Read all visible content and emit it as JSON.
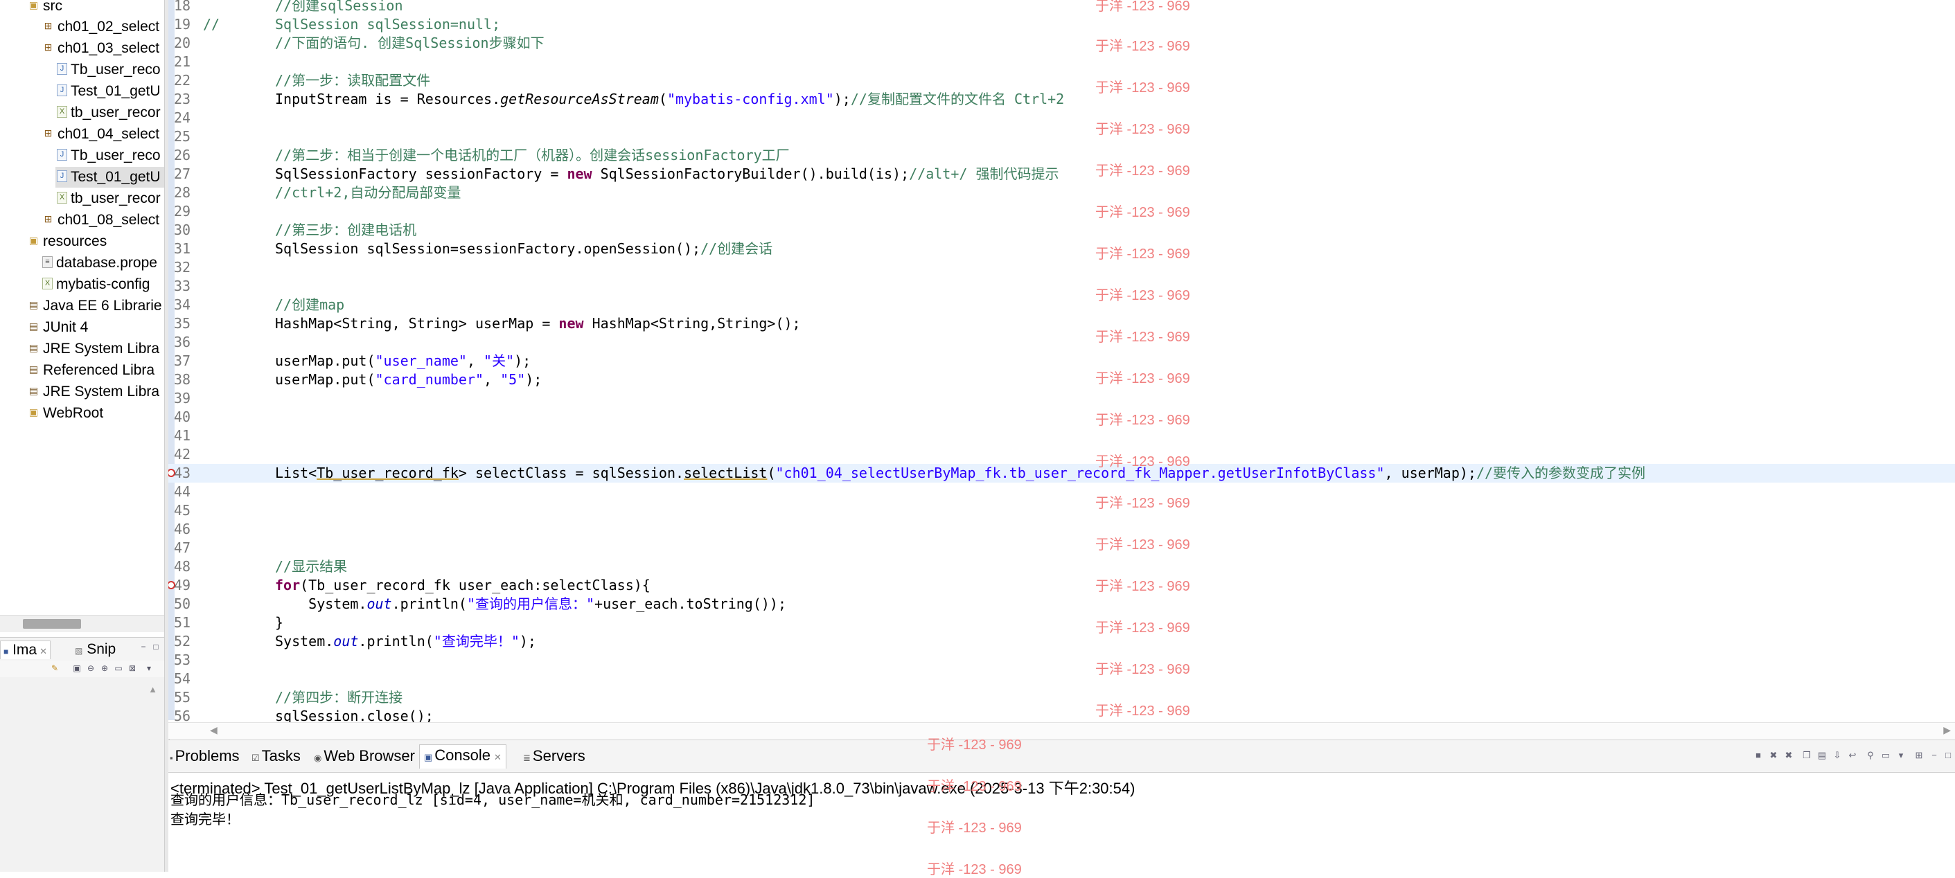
{
  "package_explorer": {
    "items": [
      {
        "label": "src",
        "icon": "folder-icon"
      },
      {
        "label": "ch01_02_select",
        "icon": "package-icon"
      },
      {
        "label": "ch01_03_select",
        "icon": "package-icon"
      },
      {
        "label": "Tb_user_reco",
        "icon": "java-file-icon"
      },
      {
        "label": "Test_01_getU",
        "icon": "java-file-icon"
      },
      {
        "label": "tb_user_recor",
        "icon": "xml-file-icon"
      },
      {
        "label": "ch01_04_select",
        "icon": "package-icon"
      },
      {
        "label": "Tb_user_reco",
        "icon": "java-file-icon"
      },
      {
        "label": "Test_01_getU",
        "icon": "java-file-icon"
      },
      {
        "label": "tb_user_recor",
        "icon": "xml-file-icon"
      },
      {
        "label": "ch01_08_select",
        "icon": "package-icon"
      },
      {
        "label": "resources",
        "icon": "folder-icon"
      },
      {
        "label": "database.prope",
        "icon": "properties-file-icon"
      },
      {
        "label": "mybatis-config",
        "icon": "xml-file-icon"
      },
      {
        "label": "Java EE 6 Librarie",
        "icon": "library-icon"
      },
      {
        "label": "JUnit 4",
        "icon": "library-icon"
      },
      {
        "label": "JRE System Libra",
        "icon": "library-icon"
      },
      {
        "label": "Referenced Libra",
        "icon": "library-icon"
      },
      {
        "label": "JRE System Libra",
        "icon": "library-icon"
      },
      {
        "label": "WebRoot",
        "icon": "folder-icon"
      }
    ]
  },
  "left_tabs": {
    "tab1": "Ima",
    "tab2": "Snip"
  },
  "editor": {
    "line_numbers": [
      "18",
      "19",
      "20",
      "21",
      "22",
      "23",
      "24",
      "25",
      "26",
      "27",
      "28",
      "29",
      "30",
      "31",
      "32",
      "33",
      "34",
      "35",
      "36",
      "37",
      "38",
      "39",
      "40",
      "41",
      "42",
      "43",
      "44",
      "45",
      "46",
      "47",
      "48",
      "49",
      "50",
      "51",
      "52",
      "53",
      "54",
      "55",
      "56"
    ],
    "code": {
      "l18_comment": "//创建sqlSession",
      "l19_prefix": "//",
      "l19_code": "SqlSession sqlSession=null;",
      "l20_comment": "//下面的语句. 创建SqlSession步骤如下",
      "l22_comment": "//第一步：读取配置文件",
      "l23_a": "InputStream is = Resources.",
      "l23_method": "getResourceAsStream",
      "l23_b": "(",
      "l23_str": "\"mybatis-config.xml\"",
      "l23_c": ");",
      "l23_comment": "//复制配置文件的文件名 Ctrl+2",
      "l26_comment": "//第二步：相当于创建一个电话机的工厂（机器）。创建会话sessionFactory工厂",
      "l27_a": "SqlSessionFactory sessionFactory = ",
      "l27_kw": "new",
      "l27_b": " SqlSessionFactoryBuilder().build(is);",
      "l27_comment": "//alt+/ 强制代码提示",
      "l28_comment": "//ctrl+2,自动分配局部变量",
      "l30_comment": "//第三步：创建电话机",
      "l31_a": "SqlSession sqlSession=sessionFactory.openSession();",
      "l31_comment": "//创建会话",
      "l34_comment": "//创建map",
      "l35_a": "HashMap<String, String> userMap = ",
      "l35_kw": "new",
      "l35_b": " HashMap<String,String>();",
      "l37_a": "userMap.put(",
      "l37_s1": "\"user_name\"",
      "l37_b": ", ",
      "l37_s2": "\"关\"",
      "l37_c": ");",
      "l38_a": "userMap.put(",
      "l38_s1": "\"card_number\"",
      "l38_b": ", ",
      "l38_s2": "\"5\"",
      "l38_c": ");",
      "l43_a": "List<",
      "l43_type": "Tb_user_record_fk",
      "l43_b": "> selectClass = sqlSession.",
      "l43_method": "selectList",
      "l43_c": "(",
      "l43_str": "\"ch01_04_selectUserByMap_fk.tb_user_record_fk_Mapper.getUserInfotByClass\"",
      "l43_d": ", userMap);",
      "l43_comment": "//要传入的参数变成了实例",
      "l48_comment": "//显示结果",
      "l49_kw": "for",
      "l49_a": "(Tb_user_record_fk user_each:selectClass){",
      "l50_a": "    System.",
      "l50_field": "out",
      "l50_b": ".println(",
      "l50_str": "\"查询的用户信息：\"",
      "l50_c": "+user_each.toString());",
      "l51_a": "}",
      "l52_a": "System.",
      "l52_field": "out",
      "l52_b": ".println(",
      "l52_str": "\"查询完毕！\"",
      "l52_c": ");",
      "l55_comment": "//第四步：断开连接",
      "l56_a": "sqlSession.close();"
    },
    "watermark": "于洋 -123 - 969"
  },
  "console": {
    "tabs": [
      {
        "label": "Problems",
        "icon": "problems-icon"
      },
      {
        "label": "Tasks",
        "icon": "tasks-icon"
      },
      {
        "label": "Web Browser",
        "icon": "globe-icon"
      },
      {
        "label": "Console",
        "icon": "console-icon"
      },
      {
        "label": "Servers",
        "icon": "servers-icon"
      }
    ],
    "status": "<terminated> Test_01_getUserListByMap_lz [Java Application] C:\\Program Files (x86)\\Java\\jdk1.8.0_73\\bin\\javaw.exe (2025-3-13 下午2:30:54)",
    "out1_prefix": "查询的用户信息：",
    "out1_body": "Tb_user_record_lz [sid=4, user_name=",
    "out1_name": "机关和",
    "out1_tail": ", card_number=21512312]",
    "out2": "查询完毕！"
  }
}
